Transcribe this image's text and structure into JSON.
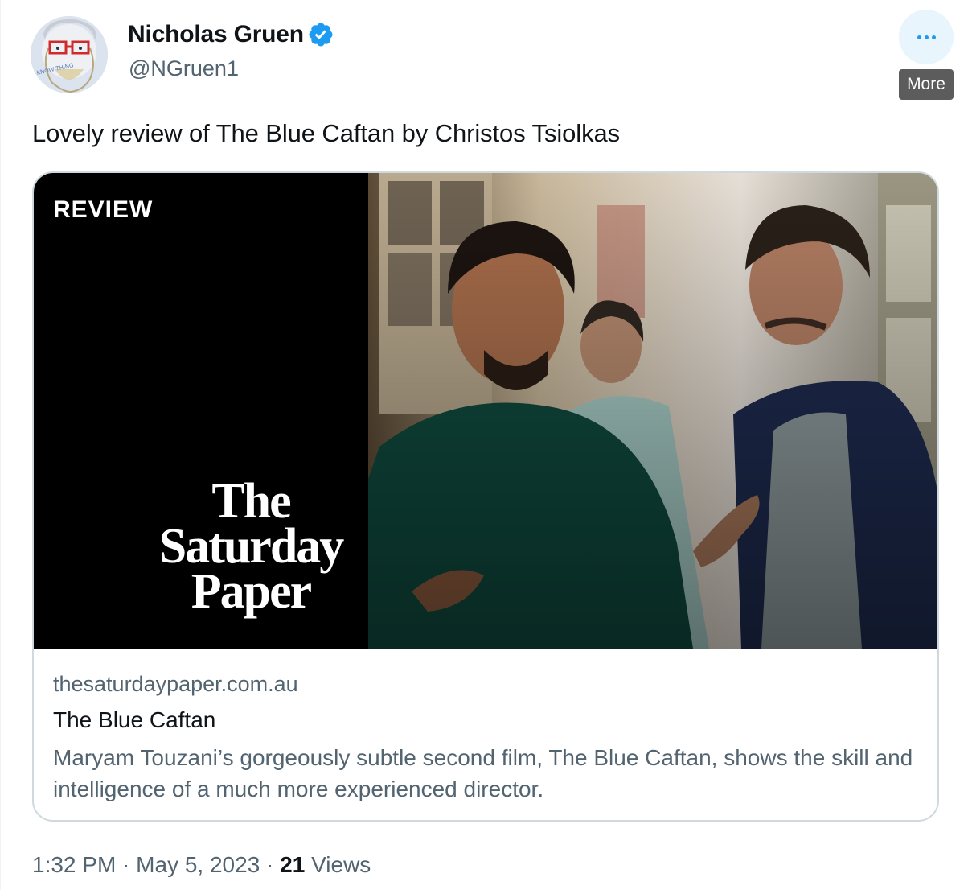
{
  "author": {
    "name": "Nicholas Gruen",
    "handle": "@NGruen1",
    "verified_icon": "verified-badge-icon",
    "avatar_text": "KNOW THING"
  },
  "more": {
    "icon": "more-horizontal-icon",
    "tooltip": "More"
  },
  "tweet": {
    "text": "Lovely review of The Blue Caftan by Christos Tsiolkas"
  },
  "card": {
    "media_label": "REVIEW",
    "logo_lines": [
      "The",
      "Saturday",
      "Paper"
    ],
    "domain": "thesaturdaypaper.com.au",
    "title": "The Blue Caftan",
    "description": "Maryam Touzani’s gorgeously subtle second film, The Blue Caftan, shows the skill and intelligence of a much more experienced director."
  },
  "meta": {
    "time": "1:32 PM",
    "separator": " · ",
    "date": "May 5, 2023",
    "views_count": "21",
    "views_label": "Views"
  },
  "colors": {
    "accent": "#1d9bf0",
    "text_primary": "#0f1419",
    "text_secondary": "#536471",
    "border": "#cfd9de"
  }
}
